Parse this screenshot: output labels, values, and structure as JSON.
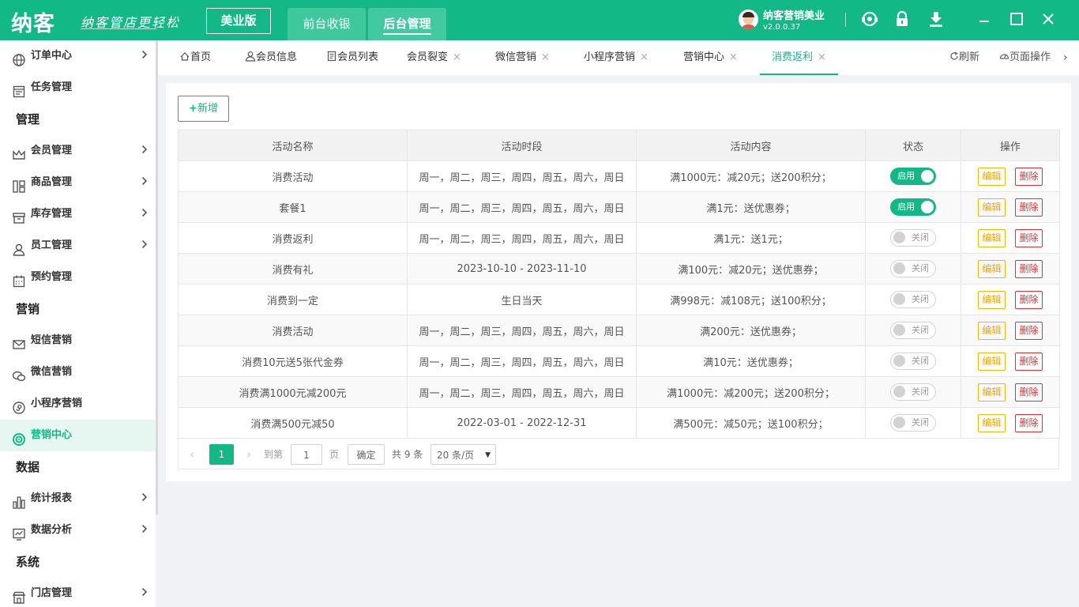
{
  "header": {
    "logo": "纳客",
    "slogan": "纳客管店更轻松",
    "edition": "美业版",
    "modules": [
      "前台收银",
      "后台管理"
    ],
    "user_name": "纳客营销美业",
    "version": "v2.0.0.37",
    "icons": [
      "support-icon",
      "lock-icon",
      "download-icon",
      "minimize-icon",
      "maximize-icon",
      "close-icon"
    ]
  },
  "sidebar": {
    "items": [
      {
        "type": "item",
        "label": "订单中心",
        "icon": "globe-icon",
        "arrow": true
      },
      {
        "type": "item",
        "label": "任务管理",
        "icon": "task-icon",
        "arrow": false
      },
      {
        "type": "group",
        "label": "管理"
      },
      {
        "type": "item",
        "label": "会员管理",
        "icon": "crown-icon",
        "arrow": true
      },
      {
        "type": "item",
        "label": "商品管理",
        "icon": "goods-icon",
        "arrow": true
      },
      {
        "type": "item",
        "label": "库存管理",
        "icon": "inventory-icon",
        "arrow": true
      },
      {
        "type": "item",
        "label": "员工管理",
        "icon": "staff-icon",
        "arrow": true
      },
      {
        "type": "item",
        "label": "预约管理",
        "icon": "calendar-icon",
        "arrow": false
      },
      {
        "type": "group",
        "label": "营销"
      },
      {
        "type": "item",
        "label": "短信营销",
        "icon": "mail-icon",
        "arrow": false
      },
      {
        "type": "item",
        "label": "微信营销",
        "icon": "wechat-icon",
        "arrow": false
      },
      {
        "type": "item",
        "label": "小程序营销",
        "icon": "miniprogram-icon",
        "arrow": false
      },
      {
        "type": "item",
        "label": "营销中心",
        "icon": "target-icon",
        "arrow": false,
        "active": true
      },
      {
        "type": "group",
        "label": "数据"
      },
      {
        "type": "item",
        "label": "统计报表",
        "icon": "bar-chart-icon",
        "arrow": true
      },
      {
        "type": "item",
        "label": "数据分析",
        "icon": "analysis-icon",
        "arrow": true
      },
      {
        "type": "group",
        "label": "系统"
      },
      {
        "type": "item",
        "label": "门店管理",
        "icon": "store-icon",
        "arrow": true
      }
    ]
  },
  "tabs": {
    "items": [
      {
        "label": "首页",
        "icon": "home-icon",
        "closable": false
      },
      {
        "label": "会员信息",
        "icon": "user-icon",
        "closable": false
      },
      {
        "label": "会员列表",
        "icon": "list-icon",
        "closable": false
      },
      {
        "label": "会员裂变",
        "closable": true
      },
      {
        "label": "微信营销",
        "closable": true
      },
      {
        "label": "小程序营销",
        "closable": true
      },
      {
        "label": "营销中心",
        "closable": true
      },
      {
        "label": "消费返利",
        "closable": true,
        "active": true
      }
    ],
    "close_glyph": "×",
    "refresh": "刷新",
    "page_ops": "页面操作"
  },
  "toolbar": {
    "add_label": "新增"
  },
  "table": {
    "headers": [
      "活动名称",
      "活动时段",
      "活动内容",
      "状态",
      "操作"
    ],
    "rows": [
      {
        "name": "消费活动",
        "period": "周一，周二，周三，周四，周五，周六，周日",
        "content": "满1000元：减20元；送200积分；",
        "enabled": true
      },
      {
        "name": "套餐1",
        "period": "周一，周二，周三，周四，周五，周六，周日",
        "content": "满1元：送优惠券；",
        "enabled": true
      },
      {
        "name": "消费返利",
        "period": "周一，周二，周三，周四，周五，周六，周日",
        "content": "满1元：送1元；",
        "enabled": false
      },
      {
        "name": "消费有礼",
        "period": "2023-10-10 - 2023-11-10",
        "content": "满100元：减20元；送优惠券；",
        "enabled": false
      },
      {
        "name": "消费到一定",
        "period": "生日当天",
        "content": "满998元：减108元；送100积分；",
        "enabled": false
      },
      {
        "name": "消费活动",
        "period": "周一，周二，周三，周四，周五，周六，周日",
        "content": "满200元：送优惠券；",
        "enabled": false
      },
      {
        "name": "消费10元送5张代金券",
        "period": "周一，周二，周三，周四，周五，周六，周日",
        "content": "满10元：送优惠券；",
        "enabled": false
      },
      {
        "name": "消费满1000元减200元",
        "period": "周一，周二，周三，周四，周五，周六，周日",
        "content": "满1000元：减200元；送200积分；",
        "enabled": false
      },
      {
        "name": "消费满500元减50",
        "period": "2022-03-01 - 2022-12-31",
        "content": "满500元：减50元；送100积分；",
        "enabled": false
      }
    ],
    "switch_on": "启用",
    "switch_off": "关闭",
    "edit": "编辑",
    "delete": "删除"
  },
  "pager": {
    "current": "1",
    "goto_label": "到第",
    "goto_value": "1",
    "page_unit": "页",
    "confirm": "确定",
    "total": "共 9 条",
    "page_size": "20 条/页"
  },
  "colors": {
    "brand": "#13b887",
    "edit": "#f5a300",
    "delete": "#e63030"
  }
}
